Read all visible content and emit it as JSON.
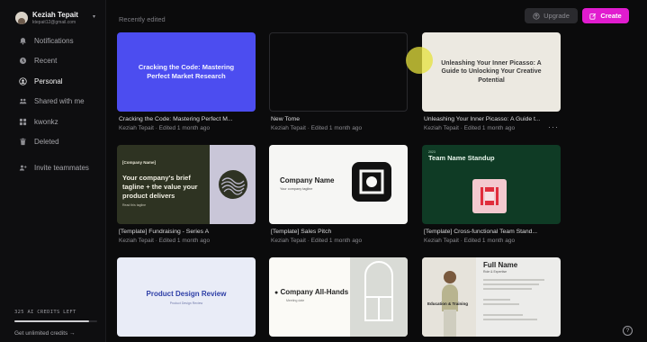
{
  "user": {
    "name": "Keziah Tepait",
    "email": "ktepait12@gmail.com"
  },
  "nav": [
    {
      "label": "Notifications",
      "icon": "bell-icon"
    },
    {
      "label": "Recent",
      "icon": "clock-icon"
    },
    {
      "label": "Personal",
      "icon": "person-icon",
      "active": true
    },
    {
      "label": "Shared with me",
      "icon": "people-icon"
    },
    {
      "label": "kwonkz",
      "icon": "grid-icon"
    },
    {
      "label": "Deleted",
      "icon": "trash-icon"
    },
    {
      "label": "Invite teammates",
      "icon": "add-user-icon"
    }
  ],
  "credits": {
    "label": "325 AI CREDITS LEFT",
    "fraction": 0.9,
    "cta": "Get unlimited credits →"
  },
  "header": {
    "section": "Recently edited",
    "upgrade": "Upgrade",
    "create": "Create"
  },
  "cards": [
    {
      "title": "Cracking the Code: Mastering Perfect M...",
      "meta": "Keziah Tepait · Edited 1 month ago",
      "thumb_text": "Cracking the Code: Mastering Perfect Market Research"
    },
    {
      "title": "New Tome",
      "meta": "Keziah Tepait · Edited 1 month ago"
    },
    {
      "title": "Unleashing Your Inner Picasso: A Guide t...",
      "meta": "Keziah Tepait · Edited 1 month ago",
      "thumb_text": "Unleashing Your Inner Picasso: A Guide to Unlocking Your Creative Potential",
      "more": "···"
    },
    {
      "title": "[Template] Fundraising - Series A",
      "meta": "Keziah Tepait · Edited 1 month ago",
      "thumb_tag": "[Company Name]",
      "thumb_text": "Your company's brief tagline + the value your product delivers",
      "thumb_foot": "Read this tagline"
    },
    {
      "title": "[Template] Sales Pitch",
      "meta": "Keziah Tepait · Edited 1 month ago",
      "thumb_text": "Company Name",
      "thumb_sub": "Your company tagline"
    },
    {
      "title": "[Template] Cross-functional Team Stand...",
      "meta": "Keziah Tepait · Edited 1 month ago",
      "thumb_mini": "2023",
      "thumb_text": "Team Name Standup"
    },
    {
      "thumb_text": "Product Design Review",
      "thumb_sub": "Product Design Review"
    },
    {
      "thumb_text": "Company All-Hands",
      "thumb_sub": "Meeting date"
    },
    {
      "thumb_text": "Full Name",
      "thumb_sub": "Role & Expertise",
      "thumb_edu": "Education & Training"
    }
  ],
  "help": "?"
}
